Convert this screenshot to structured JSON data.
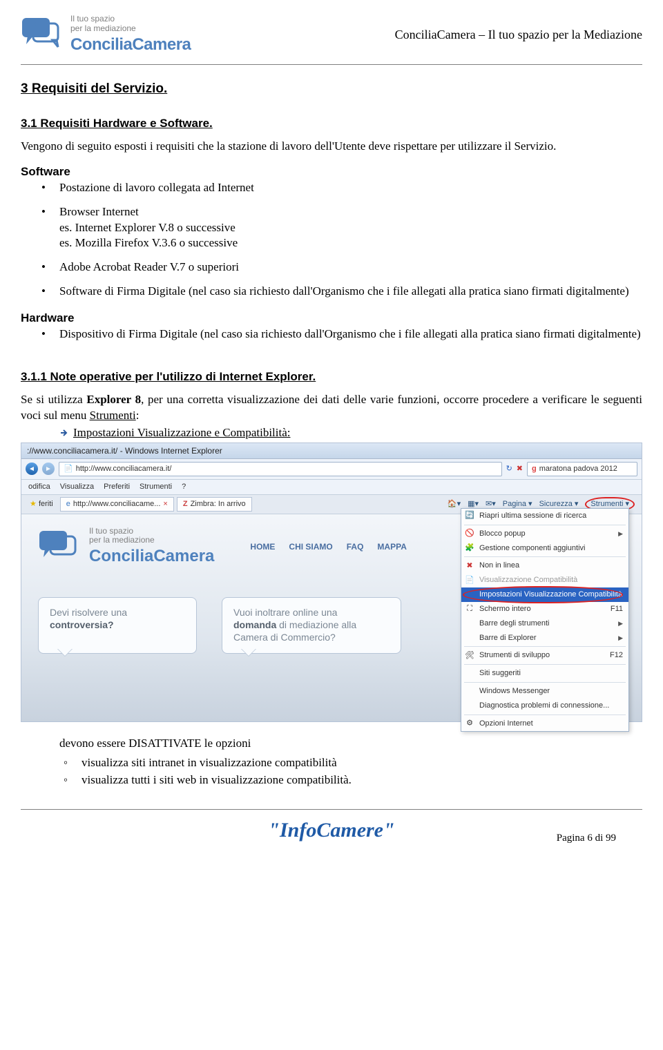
{
  "header": {
    "logo_main": "ConciliaCamera",
    "tagline_line1": "Il tuo spazio",
    "tagline_line2": "per la mediazione",
    "doc_title": "ConciliaCamera – Il tuo spazio per la Mediazione"
  },
  "section_3": {
    "heading": " 3 Requisiti del Servizio.",
    "sub_3_1": " 3.1 Requisiti Hardware e Software.",
    "intro": "Vengono di seguito esposti i requisiti che la stazione di lavoro dell'Utente deve rispettare per utilizzare il Servizio.",
    "software_label": "Software",
    "software_items": [
      "Postazione di lavoro collegata ad Internet",
      "Browser Internet\nes. Internet Explorer V.8 o successive\nes. Mozilla Firefox V.3.6 o successive",
      "Adobe Acrobat Reader V.7 o superiori",
      "Software di Firma Digitale (nel caso sia richiesto dall'Organismo che i file allegati alla pratica siano firmati digitalmente)"
    ],
    "hardware_label": "Hardware",
    "hardware_items": [
      "Dispositivo di Firma Digitale (nel caso sia richiesto dall'Organismo che i file allegati alla pratica siano firmati digitalmente)"
    ]
  },
  "section_311": {
    "heading": "3.1.1 Note operative per l'utilizzo di Internet Explorer.",
    "para_prefix": "Se si utilizza ",
    "para_bold": "Explorer 8",
    "para_mid": ", per una corretta visualizzazione dei dati delle varie funzioni, occorre procedere a verificare le seguenti voci sul menu ",
    "para_link": "Strumenti",
    "bullet_link": "Impostazioni Visualizzazione e Compatibilità:",
    "post_note": "devono essere DISATTIVATE le opzioni",
    "sub_items": [
      "visualizza siti intranet in visualizzazione compatibilità",
      "visualizza tutti i siti web in visualizzazione compatibilità."
    ]
  },
  "ie": {
    "titlebar": "://www.conciliacamera.it/ - Windows Internet Explorer",
    "url": "http://www.conciliacamera.it/",
    "search_text": "maratona padova 2012",
    "menubar": [
      "odifica",
      "Visualizza",
      "Preferiti",
      "Strumenti",
      "?"
    ],
    "fav_label": "feriti",
    "tab1": "http://www.conciliacame...",
    "tab2": "Zimbra: In arrivo",
    "toolbar_right": {
      "pagina": "Pagina",
      "sicurezza": "Sicurezza",
      "strumenti": "Strumenti"
    },
    "dropdown": {
      "riapri": "Riapri ultima sessione di ricerca",
      "blocco": "Blocco popup",
      "gestione": "Gestione componenti aggiuntivi",
      "nonlinea": "Non in linea",
      "viscomp_disabled": "Visualizzazione Compatibilità",
      "impost_viscomp": "Impostazioni Visualizzazione Compatibilità",
      "schermo": "Schermo intero",
      "schermo_key": "F11",
      "barre_strumenti": "Barre degli strumenti",
      "barre_explorer": "Barre di Explorer",
      "sviluppo": "Strumenti di sviluppo",
      "sviluppo_key": "F12",
      "suggeriti": "Siti suggeriti",
      "messenger": "Windows Messenger",
      "diagnostica": "Diagnostica problemi di connessione...",
      "opzioni": "Opzioni Internet"
    },
    "page": {
      "logo": "ConciliaCamera",
      "tag1": "Il tuo spazio",
      "tag2": "per la mediazione",
      "nav": [
        "HOME",
        "CHI SIAMO",
        "FAQ",
        "MAPPA"
      ],
      "bubble1_a": "Devi risolvere una",
      "bubble1_b": "controversia?",
      "bubble2_a": "Vuoi inoltrare online una",
      "bubble2_b": "domanda",
      "bubble2_c": " di mediazione alla",
      "bubble2_d": "Camera di Commercio?"
    }
  },
  "footer": {
    "infocamere": "\"InfoCamere\"",
    "page_no": "Pagina 6 di 99"
  }
}
